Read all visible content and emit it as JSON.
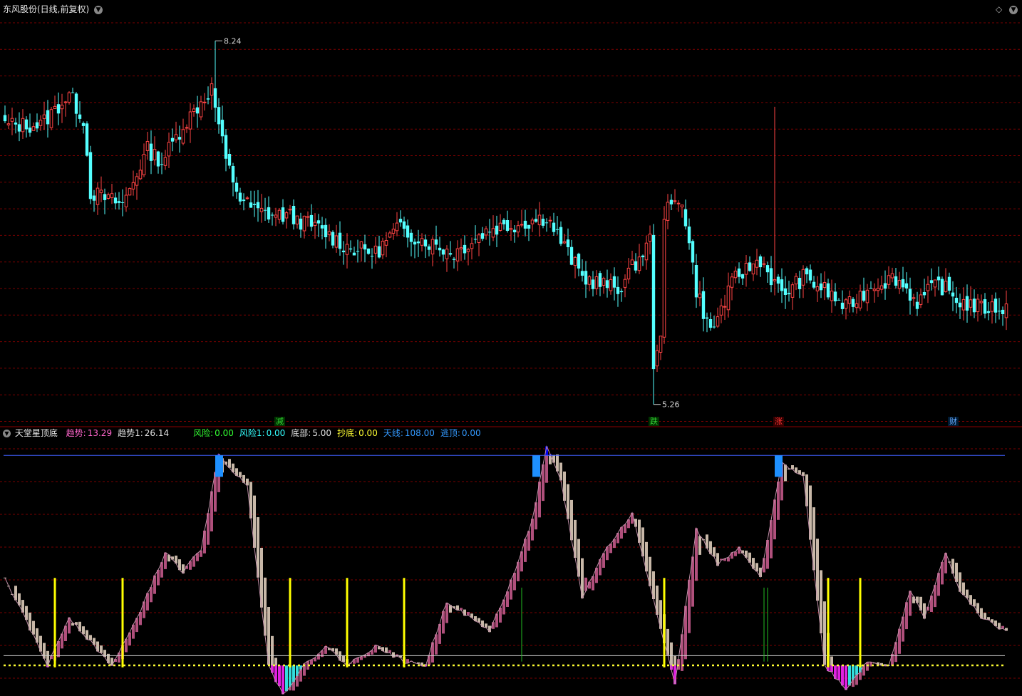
{
  "header": {
    "title": "东风股份(日线,前复权)",
    "collapse_icon": "chevron-down-circle-icon",
    "right_icons": [
      "diamond-icon",
      "chevron-down-circle-icon"
    ]
  },
  "price_panel": {
    "high_marker": "8.24",
    "low_marker": "5.26",
    "event_tags": [
      {
        "label": "减",
        "color": "#33cc33",
        "bg": "#003300"
      },
      {
        "label": "跌",
        "color": "#33cc33",
        "bg": "#003300"
      },
      {
        "label": "涨",
        "color": "#ff3333",
        "bg": "#330000"
      },
      {
        "label": "财",
        "color": "#66aaff",
        "bg": "#001a33"
      }
    ]
  },
  "indicator_panel": {
    "name": "天堂星顶底",
    "values": [
      {
        "label": "趋势:",
        "value": "13.29",
        "label_color": "#ff66cc",
        "value_color": "#ff66cc"
      },
      {
        "label": "趋势1:",
        "value": "26.14",
        "label_color": "#e0e0e0",
        "value_color": "#e0e0e0"
      },
      {
        "label": "风险:",
        "value": "0.00",
        "label_color": "#33ff33",
        "value_color": "#33ff33"
      },
      {
        "label": "风险1:",
        "value": "0.00",
        "label_color": "#33ffff",
        "value_color": "#33ffff"
      },
      {
        "label": "底部:",
        "value": "5.00",
        "label_color": "#e0e0e0",
        "value_color": "#e0e0e0"
      },
      {
        "label": "抄底:",
        "value": "0.00",
        "label_color": "#ffff33",
        "value_color": "#ffff33"
      },
      {
        "label": "天线:",
        "value": "108.00",
        "label_color": "#3399ff",
        "value_color": "#3399ff"
      },
      {
        "label": "逃顶:",
        "value": "0.00",
        "label_color": "#3399ff",
        "value_color": "#3399ff"
      }
    ]
  },
  "colors": {
    "up": "#ff4444",
    "down": "#54ffff",
    "grid": "#7a0000",
    "trend_rise": "#b0507c",
    "trend_fall": "#c8b8a8",
    "buy_signal": "#ffff00",
    "top_signal": "#1e90ff",
    "sky_line": "#4060ff"
  },
  "chart_data": [
    {
      "type": "candlestick",
      "title": "东风股份(日线,前复权)",
      "price_high": 8.24,
      "price_low": 5.26,
      "ylim": [
        5.2,
        8.4
      ],
      "gridlines": "dashed red, horizontal",
      "keypoints_close": [
        [
          0,
          7.55
        ],
        [
          10,
          7.55
        ],
        [
          18,
          7.8
        ],
        [
          22,
          7.6
        ],
        [
          24,
          7.0
        ],
        [
          28,
          6.95
        ],
        [
          33,
          6.9
        ],
        [
          40,
          7.35
        ],
        [
          44,
          7.25
        ],
        [
          50,
          7.55
        ],
        [
          58,
          7.85
        ],
        [
          62,
          7.25
        ],
        [
          66,
          6.95
        ],
        [
          70,
          6.85
        ],
        [
          74,
          6.82
        ],
        [
          80,
          6.8
        ],
        [
          88,
          6.7
        ],
        [
          96,
          6.55
        ],
        [
          104,
          6.5
        ],
        [
          110,
          6.7
        ],
        [
          118,
          6.6
        ],
        [
          126,
          6.5
        ],
        [
          136,
          6.7
        ],
        [
          146,
          6.75
        ],
        [
          152,
          6.8
        ],
        [
          158,
          6.5
        ],
        [
          162,
          6.3
        ],
        [
          172,
          6.2
        ],
        [
          180,
          6.55
        ],
        [
          184,
          6.8
        ],
        [
          190,
          6.95
        ],
        [
          194,
          6.2
        ],
        [
          198,
          5.85
        ],
        [
          205,
          6.3
        ],
        [
          212,
          6.45
        ],
        [
          218,
          6.15
        ],
        [
          224,
          6.3
        ],
        [
          230,
          6.2
        ],
        [
          236,
          6.05
        ],
        [
          244,
          6.25
        ],
        [
          250,
          6.3
        ],
        [
          256,
          6.1
        ],
        [
          262,
          6.25
        ],
        [
          268,
          6.1
        ],
        [
          274,
          6.05
        ]
      ],
      "events": [
        {
          "label": "减",
          "x_index": 77
        },
        {
          "label": "跌",
          "x_index": 182
        },
        {
          "label": "涨",
          "x_index": 217
        },
        {
          "label": "财",
          "x_index": 266
        }
      ]
    },
    {
      "type": "bar",
      "title": "天堂星顶底",
      "ylim": [
        -15,
        118
      ],
      "reference_lines": {
        "天线": 108,
        "底部": 5
      },
      "series": [
        {
          "name": "趋势",
          "keypoints": [
            [
              0,
              45
            ],
            [
              12,
              0
            ],
            [
              18,
              25
            ],
            [
              24,
              12
            ],
            [
              30,
              0
            ],
            [
              36,
              20
            ],
            [
              45,
              58
            ],
            [
              50,
              48
            ],
            [
              55,
              60
            ],
            [
              60,
              108
            ],
            [
              68,
              92
            ],
            [
              74,
              0
            ],
            [
              78,
              -15
            ],
            [
              84,
              0
            ],
            [
              90,
              10
            ],
            [
              96,
              0
            ],
            [
              104,
              10
            ],
            [
              112,
              2
            ],
            [
              118,
              0
            ],
            [
              124,
              33
            ],
            [
              130,
              25
            ],
            [
              136,
              18
            ],
            [
              141,
              38
            ],
            [
              148,
              75
            ],
            [
              152,
              112
            ],
            [
              156,
              95
            ],
            [
              162,
              35
            ],
            [
              168,
              58
            ],
            [
              176,
              78
            ],
            [
              186,
              5
            ],
            [
              188,
              -10
            ],
            [
              194,
              70
            ],
            [
              200,
              52
            ],
            [
              206,
              60
            ],
            [
              212,
              45
            ],
            [
              218,
              104
            ],
            [
              224,
              98
            ],
            [
              230,
              0
            ],
            [
              236,
              -12
            ],
            [
              242,
              2
            ],
            [
              248,
              0
            ],
            [
              254,
              38
            ],
            [
              258,
              25
            ],
            [
              264,
              58
            ],
            [
              268,
              38
            ],
            [
              274,
              25
            ],
            [
              280,
              18
            ]
          ]
        }
      ],
      "buy_signal_x_index": [
        14,
        33,
        80,
        96,
        112,
        185,
        231,
        240
      ],
      "top_signal_x_index": [
        60,
        149,
        217
      ]
    }
  ]
}
